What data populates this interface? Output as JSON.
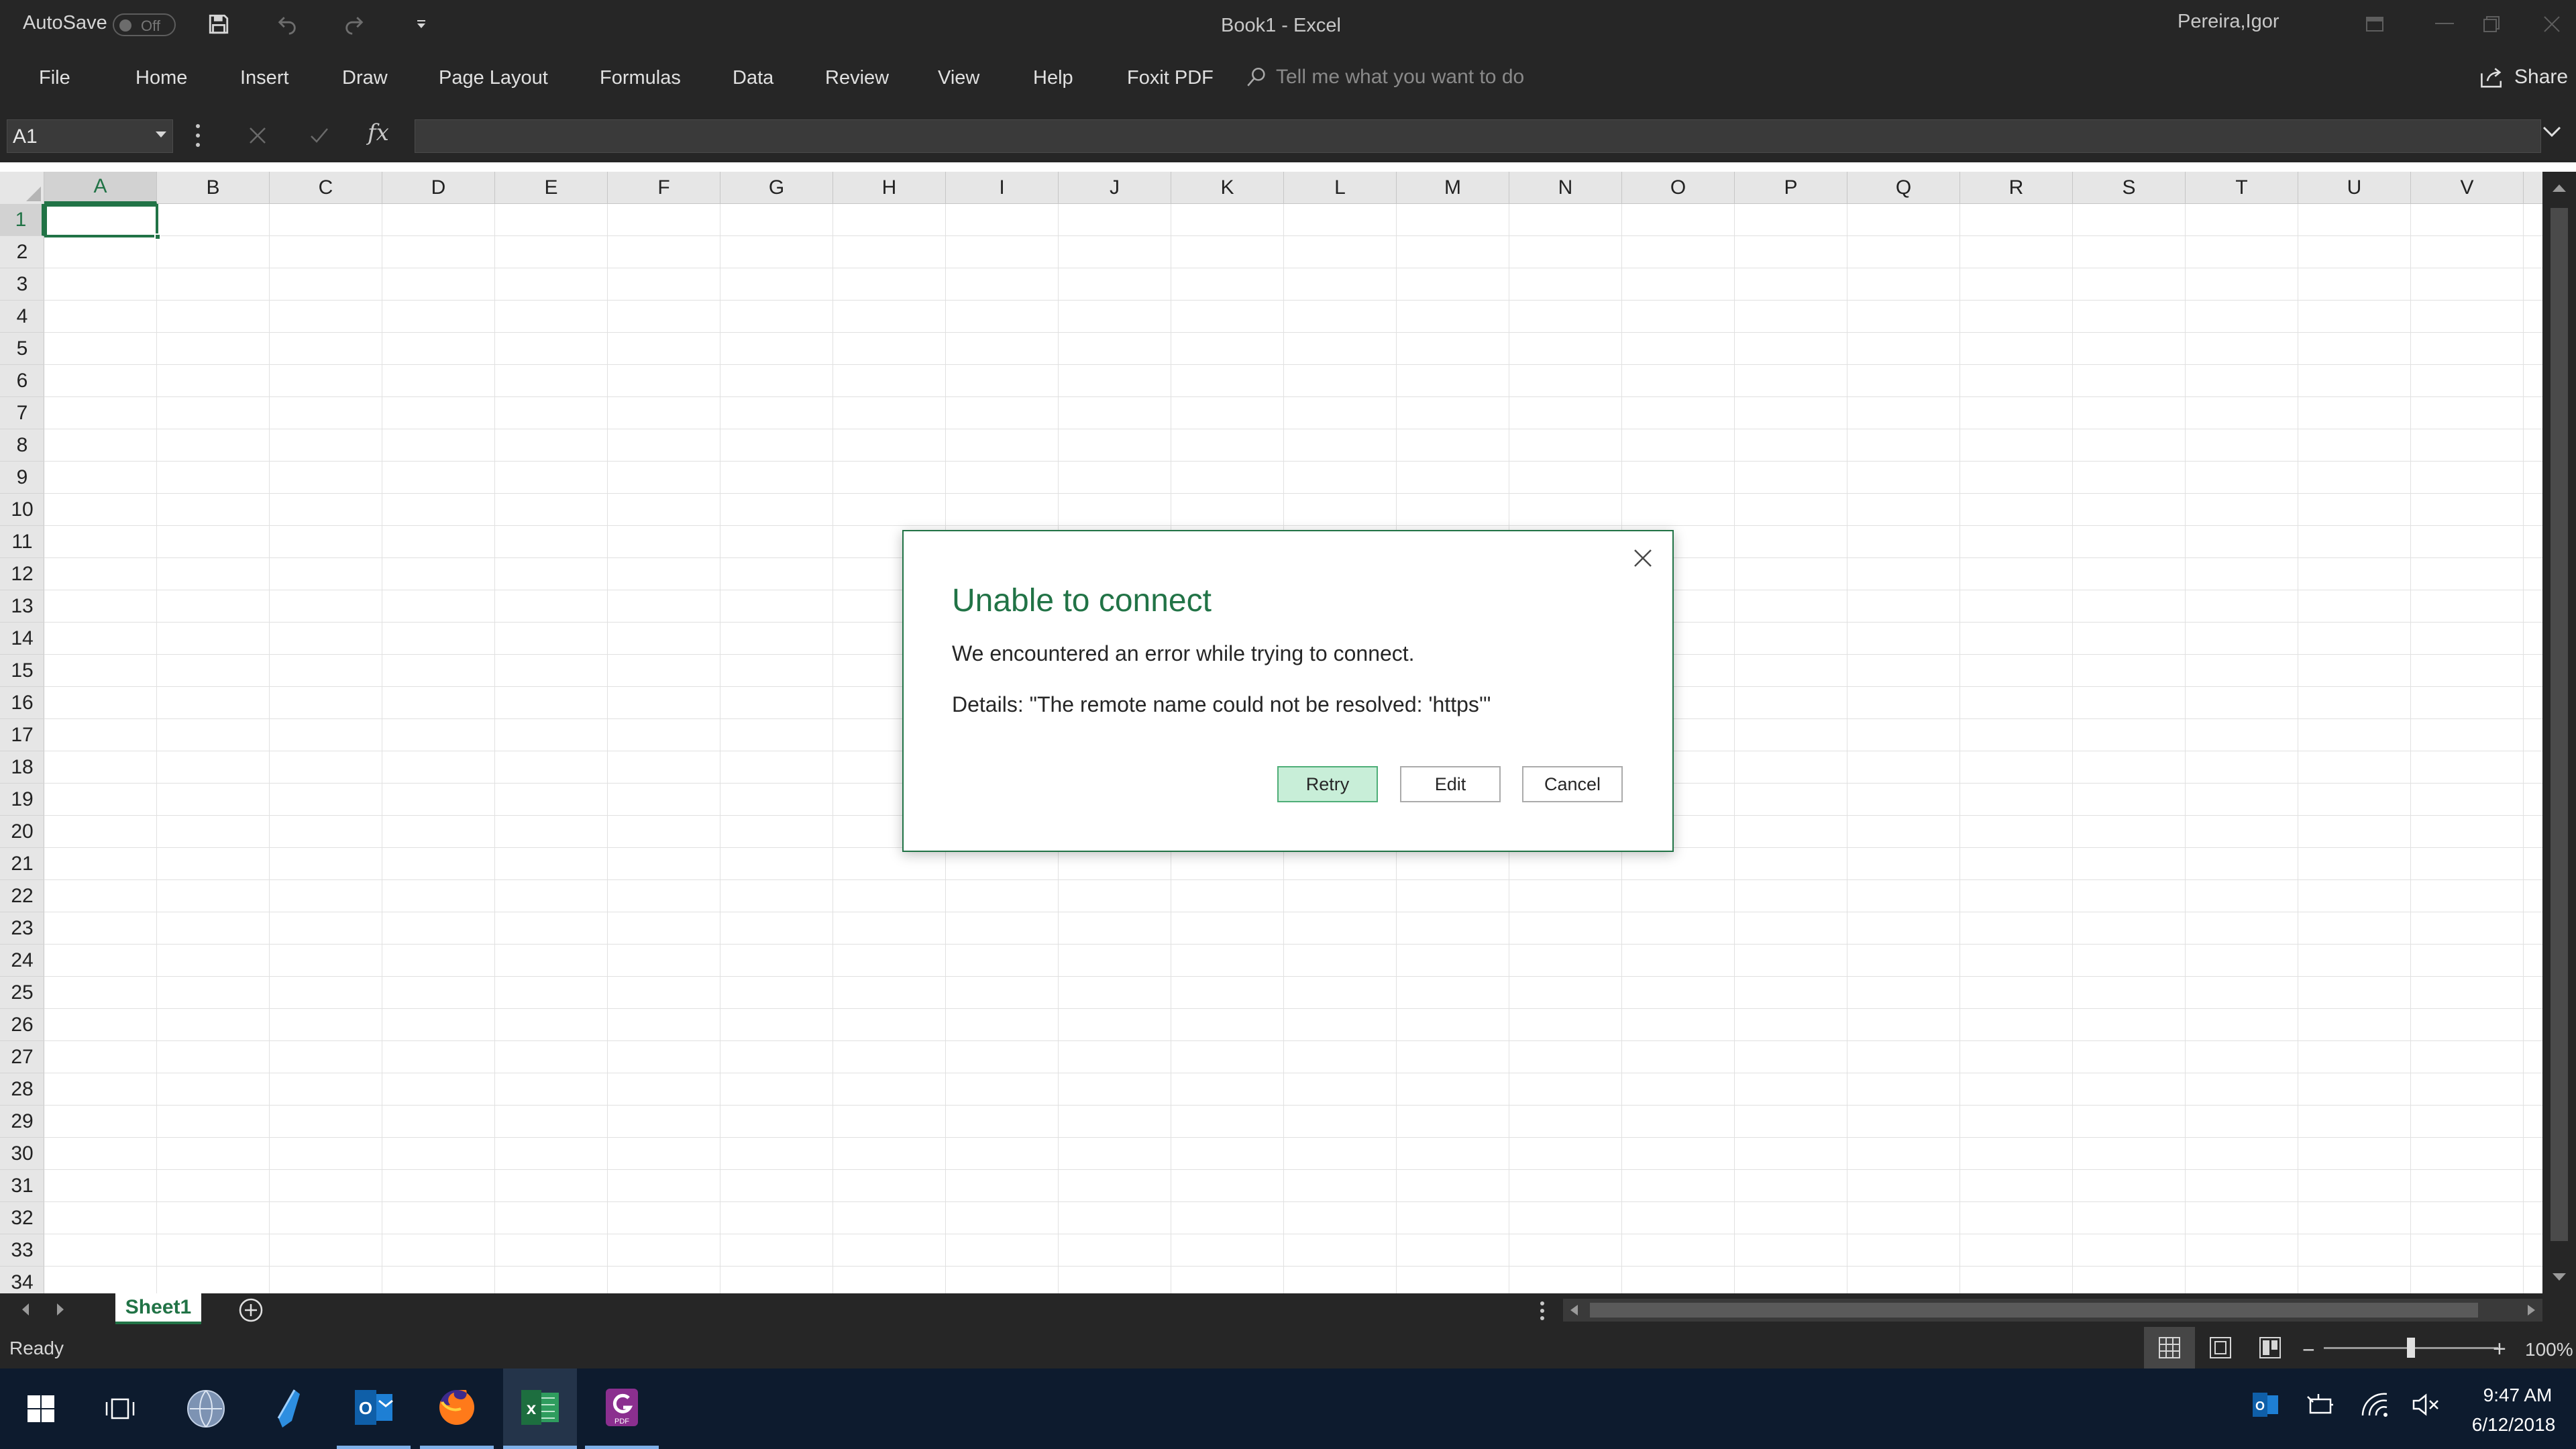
{
  "titlebar": {
    "autosave_label": "AutoSave",
    "autosave_state": "Off",
    "window_title": "Book1  -  Excel",
    "user_name": "Pereira,Igor"
  },
  "ribbon": {
    "tabs": [
      "File",
      "Home",
      "Insert",
      "Draw",
      "Page Layout",
      "Formulas",
      "Data",
      "Review",
      "View",
      "Help",
      "Foxit PDF"
    ],
    "tell_me_placeholder": "Tell me what you want to do",
    "share_label": "Share"
  },
  "formula_bar": {
    "name_box": "A1",
    "formula": "",
    "fx_label": "fx"
  },
  "grid": {
    "columns": [
      "A",
      "B",
      "C",
      "D",
      "E",
      "F",
      "G",
      "H",
      "I",
      "J",
      "K",
      "L",
      "M",
      "N",
      "O",
      "P",
      "Q",
      "R",
      "S",
      "T",
      "U",
      "V"
    ],
    "rows": [
      1,
      2,
      3,
      4,
      5,
      6,
      7,
      8,
      9,
      10,
      11,
      12,
      13,
      14,
      15,
      16,
      17,
      18,
      19,
      20,
      21,
      22,
      23,
      24,
      25,
      26,
      27,
      28,
      29,
      30,
      31,
      32,
      33,
      34
    ],
    "active_column": "A",
    "active_row": 1
  },
  "sheets": {
    "tabs": [
      "Sheet1"
    ],
    "active": "Sheet1"
  },
  "status": {
    "ready": "Ready",
    "zoom": "100%",
    "zoom_percent": 100
  },
  "dialog": {
    "title": "Unable to connect",
    "message": "We encountered an error while trying to connect.",
    "details": "Details: \"The remote name could not be resolved: 'https'\"",
    "buttons": {
      "retry": "Retry",
      "edit": "Edit",
      "cancel": "Cancel"
    }
  },
  "taskbar": {
    "apps": [
      "windows-start",
      "task-view",
      "globe-app",
      "pen-app",
      "outlook",
      "firefox",
      "excel",
      "foxit-pdf"
    ],
    "clock_time": "9:47 AM",
    "clock_date": "6/12/2018"
  },
  "colors": {
    "excel_green": "#217346",
    "dark_chrome": "#262626",
    "taskbar": "#0d1b2e",
    "retry_fill": "#c8eed8"
  }
}
